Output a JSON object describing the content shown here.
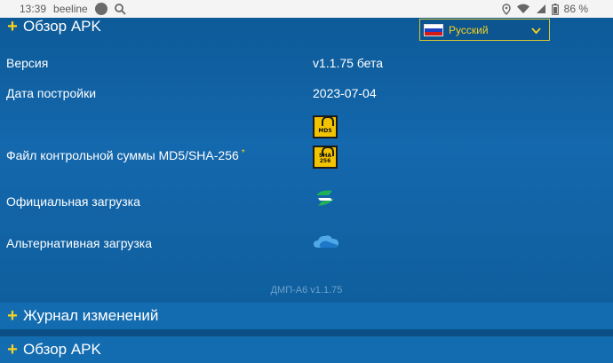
{
  "status": {
    "time": "13:39",
    "carrier": "beeline",
    "battery": "86 %"
  },
  "header": {
    "section_title": "Обзор APK"
  },
  "language": {
    "selected": "Русский",
    "flag_colors": [
      "#ffffff",
      "#1e3fbf",
      "#d21a1a"
    ]
  },
  "info": {
    "version_label": "Версия",
    "version_value": "v1.1.75 бета",
    "build_date_label": "Дата постройки",
    "build_date_value": "2023-07-04",
    "checksum_label": "Файл контрольной суммы MD5/SHA-256",
    "checksum_star": "*",
    "md5_text": "MD5",
    "sha_text": "SHA 256",
    "official_label": "Официальная загрузка",
    "alternative_label": "Альтернативная загрузка"
  },
  "footer": {
    "app_version": "ДМП-А6 v1.1.75"
  },
  "sections": {
    "changelog": "Журнал изменений",
    "apk_overview": "Обзор APK"
  },
  "colors": {
    "accent": "#f4d21f",
    "panel": "#0f5f9e",
    "bar": "#146cb0"
  }
}
